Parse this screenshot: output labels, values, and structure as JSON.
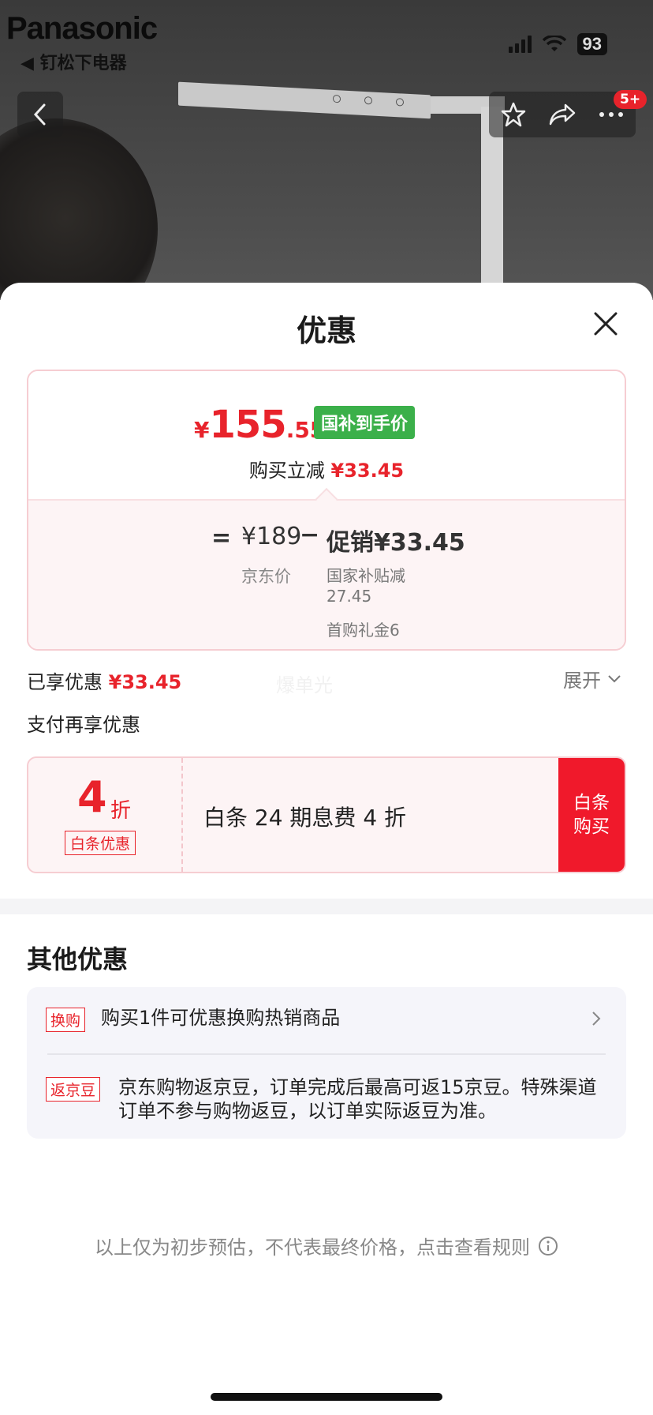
{
  "status_bar": {
    "time_logo": "Panasonic",
    "back_app": "◀ 钉",
    "overlay_text": "松下电器",
    "battery": "93"
  },
  "nav": {
    "badge": "5+"
  },
  "sheet": {
    "title": "优惠"
  },
  "price_card": {
    "currency": "¥",
    "price_int": "155",
    "price_dec": ".55",
    "tag": "国补到手价",
    "reduce_label": "购买立减",
    "reduce_value": "¥33.45",
    "equals": "=",
    "jd_price": "¥189",
    "minus": "−",
    "promo": "促销¥33.45",
    "jd_label": "京东价",
    "sub1": "国家补贴减27.45",
    "sub2": "首购礼金6"
  },
  "enjoyed": {
    "label": "已享优惠",
    "value": "¥33.45",
    "watermark": "爆单光",
    "expand_label": "展开"
  },
  "pay": {
    "title": "支付再享优惠"
  },
  "baitiao": {
    "discount_num": "4",
    "discount_unit": "折",
    "label": "白条优惠",
    "desc": "白条 24 期息费 4 折",
    "button": "白条购买"
  },
  "other": {
    "title": "其他优惠",
    "items": [
      {
        "tag": "换购",
        "text": "购买1件可优惠换购热销商品"
      },
      {
        "tag": "返京豆",
        "text": "京东购物返京豆，订单完成后最高可返15京豆。特殊渠道订单不参与购物返豆，以订单实际返豆为准。"
      }
    ]
  },
  "footnote": "以上仅为初步预估，不代表最终价格，点击查看规则",
  "colors": {
    "accent_red": "#e8232b",
    "tag_green": "#3bb04a",
    "card_border": "#f6cdd2"
  },
  "icons": [
    "back-icon",
    "star-icon",
    "share-icon",
    "more-icon",
    "close-icon",
    "chevron-down-icon",
    "chevron-right-icon",
    "info-icon"
  ]
}
